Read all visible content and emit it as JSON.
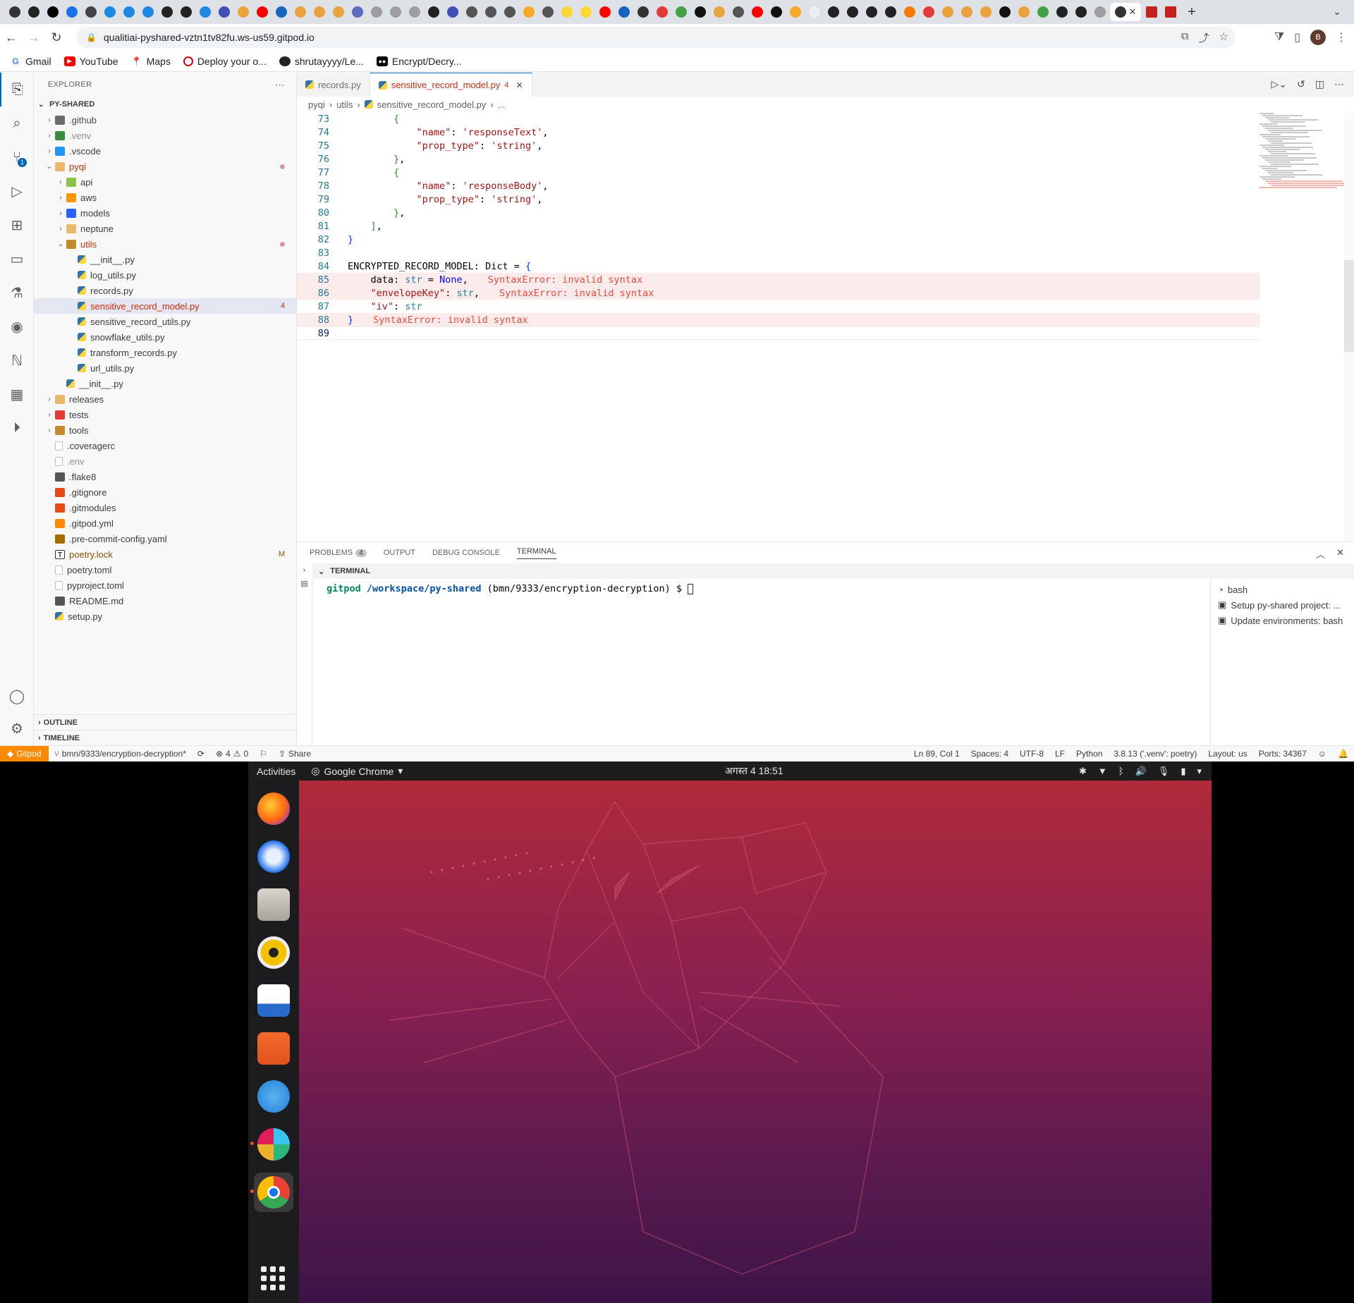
{
  "browser": {
    "url": "qualitiai-pyshared-vztn1tv82fu.ws-us59.gitpod.io",
    "avatar_letter": "B",
    "bookmarks": [
      "Gmail",
      "YouTube",
      "Maps",
      "Deploy your o...",
      "shrutayyyy/Le...",
      "Encrypt/Decry..."
    ]
  },
  "vscode": {
    "explorer_title": "EXPLORER",
    "root": "PY-SHARED",
    "tree": [
      {
        "label": ".github",
        "depth": 0,
        "chev": "›",
        "icon": "folder-github",
        "color": "#4b4b4b"
      },
      {
        "label": ".venv",
        "depth": 0,
        "chev": "›",
        "icon": "folder-venv",
        "color": "#8e8e8e"
      },
      {
        "label": ".vscode",
        "depth": 0,
        "chev": "›",
        "icon": "folder-vscode",
        "color": "#3b3b3b"
      },
      {
        "label": "pyqi",
        "depth": 0,
        "chev": "⌄",
        "icon": "folder-open",
        "color": "#c72e0f",
        "dot": true
      },
      {
        "label": "api",
        "depth": 1,
        "chev": "›",
        "icon": "folder-api",
        "color": "#3b3b3b"
      },
      {
        "label": "aws",
        "depth": 1,
        "chev": "›",
        "icon": "folder-aws",
        "color": "#3b3b3b"
      },
      {
        "label": "models",
        "depth": 1,
        "chev": "›",
        "icon": "folder-models",
        "color": "#3b3b3b"
      },
      {
        "label": "neptune",
        "depth": 1,
        "chev": "›",
        "icon": "folder-neptune",
        "color": "#3b3b3b"
      },
      {
        "label": "utils",
        "depth": 1,
        "chev": "⌄",
        "icon": "folder-utils",
        "color": "#c72e0f",
        "dot": true
      },
      {
        "label": "__init__.py",
        "depth": 2,
        "chev": "",
        "icon": "python-file",
        "color": "#3b3b3b"
      },
      {
        "label": "log_utils.py",
        "depth": 2,
        "chev": "",
        "icon": "python-file",
        "color": "#3b3b3b"
      },
      {
        "label": "records.py",
        "depth": 2,
        "chev": "",
        "icon": "python-file",
        "color": "#3b3b3b"
      },
      {
        "label": "sensitive_record_model.py",
        "depth": 2,
        "chev": "",
        "icon": "python-file",
        "color": "#c72e0f",
        "count": "4",
        "selected": true
      },
      {
        "label": "sensitive_record_utils.py",
        "depth": 2,
        "chev": "",
        "icon": "python-file",
        "color": "#3b3b3b"
      },
      {
        "label": "snowflake_utils.py",
        "depth": 2,
        "chev": "",
        "icon": "python-file",
        "color": "#3b3b3b"
      },
      {
        "label": "transform_records.py",
        "depth": 2,
        "chev": "",
        "icon": "python-file",
        "color": "#3b3b3b"
      },
      {
        "label": "url_utils.py",
        "depth": 2,
        "chev": "",
        "icon": "python-file",
        "color": "#3b3b3b"
      },
      {
        "label": "__init__.py",
        "depth": 1,
        "chev": "",
        "icon": "python-file",
        "color": "#3b3b3b"
      },
      {
        "label": "releases",
        "depth": 0,
        "chev": "›",
        "icon": "folder-releases",
        "color": "#3b3b3b"
      },
      {
        "label": "tests",
        "depth": 0,
        "chev": "›",
        "icon": "folder-tests",
        "color": "#3b3b3b"
      },
      {
        "label": "tools",
        "depth": 0,
        "chev": "›",
        "icon": "folder-tools",
        "color": "#3b3b3b"
      },
      {
        "label": ".coveragerc",
        "depth": 0,
        "chev": "",
        "icon": "file",
        "color": "#3b3b3b"
      },
      {
        "label": ".env",
        "depth": 0,
        "chev": "",
        "icon": "file",
        "color": "#8e8e8e"
      },
      {
        "label": ".flake8",
        "depth": 0,
        "chev": "",
        "icon": "gear-file",
        "color": "#3b3b3b"
      },
      {
        "label": ".gitignore",
        "depth": 0,
        "chev": "",
        "icon": "git-file",
        "color": "#3b3b3b"
      },
      {
        "label": ".gitmodules",
        "depth": 0,
        "chev": "",
        "icon": "git-file",
        "color": "#3b3b3b"
      },
      {
        "label": ".gitpod.yml",
        "depth": 0,
        "chev": "",
        "icon": "gitpod-file",
        "color": "#3b3b3b"
      },
      {
        "label": ".pre-commit-config.yaml",
        "depth": 0,
        "chev": "",
        "icon": "precommit-file",
        "color": "#3b3b3b"
      },
      {
        "label": "poetry.lock",
        "depth": 0,
        "chev": "",
        "icon": "lock-file",
        "color": "#895503",
        "mod": "M"
      },
      {
        "label": "poetry.toml",
        "depth": 0,
        "chev": "",
        "icon": "file",
        "color": "#3b3b3b"
      },
      {
        "label": "pyproject.toml",
        "depth": 0,
        "chev": "",
        "icon": "file",
        "color": "#3b3b3b"
      },
      {
        "label": "README.md",
        "depth": 0,
        "chev": "",
        "icon": "markdown-file",
        "color": "#3b3b3b"
      },
      {
        "label": "setup.py",
        "depth": 0,
        "chev": "",
        "icon": "python-file",
        "color": "#3b3b3b"
      }
    ],
    "outline": "OUTLINE",
    "timeline": "TIMELINE",
    "tabs": [
      {
        "label": "records.py",
        "active": false
      },
      {
        "label": "sensitive_record_model.py",
        "active": true,
        "count": "4"
      }
    ],
    "breadcrumb": [
      "pyqi",
      "utils",
      "sensitive_record_model.py",
      "..."
    ],
    "code": [
      {
        "n": "73",
        "html": "        <span class='k-br2'>{</span>"
      },
      {
        "n": "74",
        "html": "            <span class='k-str'>\"name\"</span>: <span class='k-str'>'responseText'</span>,"
      },
      {
        "n": "75",
        "html": "            <span class='k-str'>\"prop_type\"</span>: <span class='k-str'>'string'</span>,"
      },
      {
        "n": "76",
        "html": "        <span class='k-br2'>}</span>,"
      },
      {
        "n": "77",
        "html": "        <span class='k-br2'>{</span>"
      },
      {
        "n": "78",
        "html": "            <span class='k-str'>\"name\"</span>: <span class='k-str'>'responseBody'</span>,"
      },
      {
        "n": "79",
        "html": "            <span class='k-str'>\"prop_type\"</span>: <span class='k-str'>'string'</span>,"
      },
      {
        "n": "80",
        "html": "        <span class='k-br2'>}</span>,"
      },
      {
        "n": "81",
        "html": "    <span class='k-br2'>]</span>,"
      },
      {
        "n": "82",
        "html": "<span class='k-br'>}</span>"
      },
      {
        "n": "83",
        "html": ""
      },
      {
        "n": "84",
        "html": "ENCRYPTED_RECORD_MODEL: Dict = <span class='k-br'>{</span>"
      },
      {
        "n": "85",
        "html": "    data: <span class='k-type'>str</span> = <span class='k-kw'>None</span>,",
        "diag": "SyntaxError: invalid syntax",
        "err": true
      },
      {
        "n": "86",
        "html": "    <span class='k-str'>\"envelopeKey\"</span>: <span class='k-type'>str</span>,",
        "diag": "SyntaxError: invalid syntax",
        "err": true
      },
      {
        "n": "87",
        "html": "    <span class='k-str'>\"iv\"</span>: <span class='k-type'>str</span>"
      },
      {
        "n": "88",
        "html": "<span class='k-br'>}</span>",
        "diag": "SyntaxError: invalid syntax",
        "err": true
      },
      {
        "n": "89",
        "html": "",
        "current": true
      }
    ],
    "panel": {
      "tabs": [
        "PROBLEMS",
        "OUTPUT",
        "DEBUG CONSOLE",
        "TERMINAL"
      ],
      "problems_count": "4",
      "terminal_header": "TERMINAL",
      "prompt_user": "gitpod",
      "prompt_path": "/workspace/py-shared",
      "prompt_branch": "(bmn/9333/encryption-decryption) $",
      "terminals": [
        "bash",
        "Setup py-shared project: ...",
        "Update environments: bash"
      ]
    },
    "status": {
      "gitpod": "Gitpod",
      "branch": "bmn/9333/encryption-decryption*",
      "errors": "4",
      "warnings": "0",
      "share": "Share",
      "position": "Ln 89, Col 1",
      "spaces": "Spaces: 4",
      "encoding": "UTF-8",
      "eol": "LF",
      "language": "Python",
      "interpreter": "3.8.13 ('.venv': poetry)",
      "layout": "Layout: us",
      "ports": "Ports: 34367"
    }
  },
  "ubuntu": {
    "activities": "Activities",
    "app": "Google Chrome",
    "clock": "अगस्त 4  18:51",
    "dock": [
      "firefox-icon",
      "thunderbird-icon",
      "files-icon",
      "rhythmbox-icon",
      "writer-icon",
      "app-center-icon",
      "help-icon",
      "slack-icon",
      "chrome-icon"
    ]
  },
  "colors": {
    "accent": "#0066b8",
    "error": "#c72e0f",
    "gitpod": "#ff8a00",
    "ubuntu_orange": "#e95420"
  }
}
